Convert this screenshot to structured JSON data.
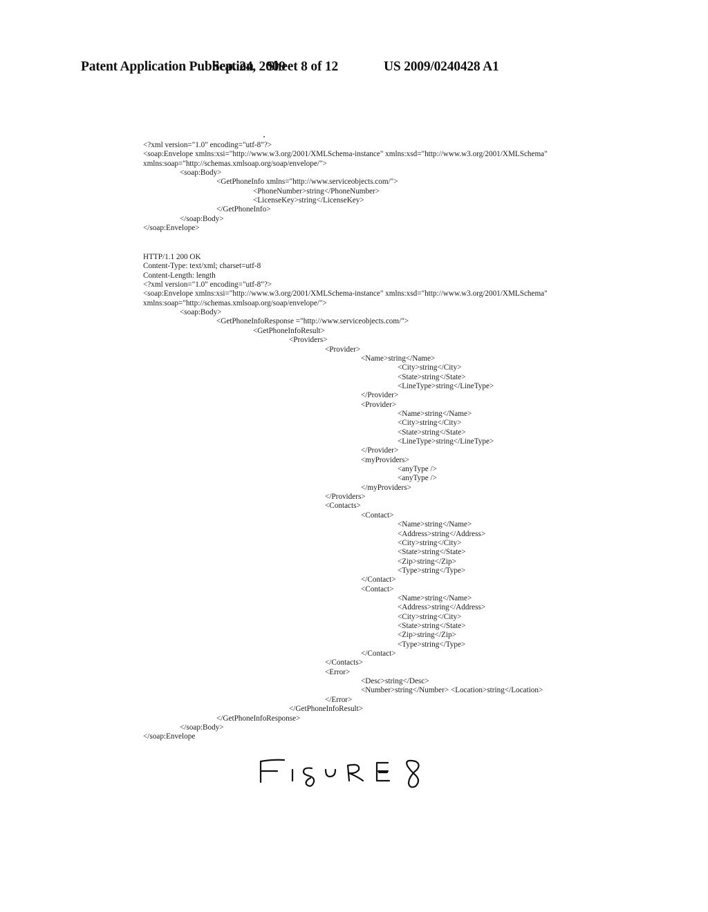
{
  "header": {
    "publication": "Patent Application Publication",
    "date": "Sep. 24, 2009",
    "sheet": "Sheet 8 of 12",
    "number": "US 2009/0240428 A1"
  },
  "request": {
    "lines": [
      {
        "indent": 0,
        "text": "<?xml version=\"1.0\" encoding=\"utf-8\"?>"
      },
      {
        "indent": 0,
        "text": "<soap:Envelope xmlns:xsi=\"http://www.w3.org/2001/XMLSchema-instance\" xmlns:xsd=\"http://www.w3.org/2001/XMLSchema\""
      },
      {
        "indent": 0,
        "text": "xmlns:soap=\"http://schemas.xmlsoap.org/soap/envelope/\">"
      },
      {
        "indent": 1,
        "text": "<soap:Body>"
      },
      {
        "indent": 2,
        "text": "<GetPhoneInfo xmlns=\"http://www.serviceobjects.com/\">"
      },
      {
        "indent": 3,
        "text": "<PhoneNumber>string</PhoneNumber>"
      },
      {
        "indent": 3,
        "text": "<LicenseKey>string</LicenseKey>"
      },
      {
        "indent": 2,
        "text": "</GetPhoneInfo>"
      },
      {
        "indent": 1,
        "text": "</soap:Body>"
      },
      {
        "indent": 0,
        "text": "</soap:Envelope>"
      }
    ]
  },
  "response": {
    "lines": [
      {
        "indent": 0,
        "text": "HTTP/1.1 200 OK"
      },
      {
        "indent": 0,
        "text": "Content-Type: text/xml; charset=utf-8"
      },
      {
        "indent": 0,
        "text": "Content-Length: length"
      },
      {
        "indent": 0,
        "text": "<?xml version=\"1.0\" encoding=\"utf-8\"?>"
      },
      {
        "indent": 0,
        "text": "<soap:Envelope xmlns:xsi=\"http://www.w3.org/2001/XMLSchema-instance\" xmlns:xsd=\"http://www.w3.org/2001/XMLSchema\""
      },
      {
        "indent": 0,
        "text": "xmlns:soap=\"http://schemas.xmlsoap.org/soap/envelope/\">"
      },
      {
        "indent": 1,
        "text": "<soap:Body>"
      },
      {
        "indent": 2,
        "text": "<GetPhoneInfoResponse =\"http://www.serviceobjects.com/\">"
      },
      {
        "indent": 3,
        "text": "<GetPhoneInfoResult>"
      },
      {
        "indent": 4,
        "text": "<Providers>"
      },
      {
        "indent": 5,
        "text": "<Provider>"
      },
      {
        "indent": 6,
        "text": "<Name>string</Name>"
      },
      {
        "indent": 7,
        "text": "<City>string</City>"
      },
      {
        "indent": 7,
        "text": "<State>string</State>"
      },
      {
        "indent": 7,
        "text": "<LineType>string</LineType>"
      },
      {
        "indent": 6,
        "text": "</Provider>"
      },
      {
        "indent": 6,
        "text": "<Provider>"
      },
      {
        "indent": 7,
        "text": "<Name>string</Name>"
      },
      {
        "indent": 7,
        "text": "<City>string</City>"
      },
      {
        "indent": 7,
        "text": "<State>string</State>"
      },
      {
        "indent": 7,
        "text": "<LineType>string</LineType>"
      },
      {
        "indent": 6,
        "text": "</Provider>"
      },
      {
        "indent": 6,
        "text": "<myProviders>"
      },
      {
        "indent": 7,
        "text": "<anyType />"
      },
      {
        "indent": 7,
        "text": "<anyType />"
      },
      {
        "indent": 6,
        "text": "</myProviders>"
      },
      {
        "indent": 5,
        "text": "</Providers>"
      },
      {
        "indent": 5,
        "text": "<Contacts>"
      },
      {
        "indent": 6,
        "text": "<Contact>"
      },
      {
        "indent": 7,
        "text": "<Name>string</Name>"
      },
      {
        "indent": 7,
        "text": "<Address>string</Address>"
      },
      {
        "indent": 7,
        "text": "<City>string</City>"
      },
      {
        "indent": 7,
        "text": "<State>string</State>"
      },
      {
        "indent": 7,
        "text": "<Zip>string</Zip>"
      },
      {
        "indent": 7,
        "text": "<Type>string</Type>"
      },
      {
        "indent": 6,
        "text": "</Contact>"
      },
      {
        "indent": 6,
        "text": "<Contact>"
      },
      {
        "indent": 7,
        "text": "<Name>string</Name>"
      },
      {
        "indent": 7,
        "text": "<Address>string</Address>"
      },
      {
        "indent": 7,
        "text": "<City>string</City>"
      },
      {
        "indent": 7,
        "text": "<State>string</State>"
      },
      {
        "indent": 7,
        "text": "<Zip>string</Zip>"
      },
      {
        "indent": 7,
        "text": "<Type>string</Type>"
      },
      {
        "indent": 6,
        "text": "</Contact>"
      },
      {
        "indent": 5,
        "text": "</Contacts>"
      },
      {
        "indent": 5,
        "text": "<Error>"
      },
      {
        "indent": 6,
        "text": "<Desc>string</Desc>"
      },
      {
        "indent": 6,
        "text": "<Number>string</Number> <Location>string</Location>"
      },
      {
        "indent": 5,
        "text": "</Error>"
      },
      {
        "indent": 4,
        "text": "</GetPhoneInfoResult>"
      },
      {
        "indent": 2,
        "text": "</GetPhoneInfoResponse>"
      },
      {
        "indent": 1,
        "text": "</soap:Body>"
      },
      {
        "indent": 0,
        "text": "</soap:Envelope"
      }
    ]
  },
  "figure": {
    "label": "FIGURE 8"
  }
}
